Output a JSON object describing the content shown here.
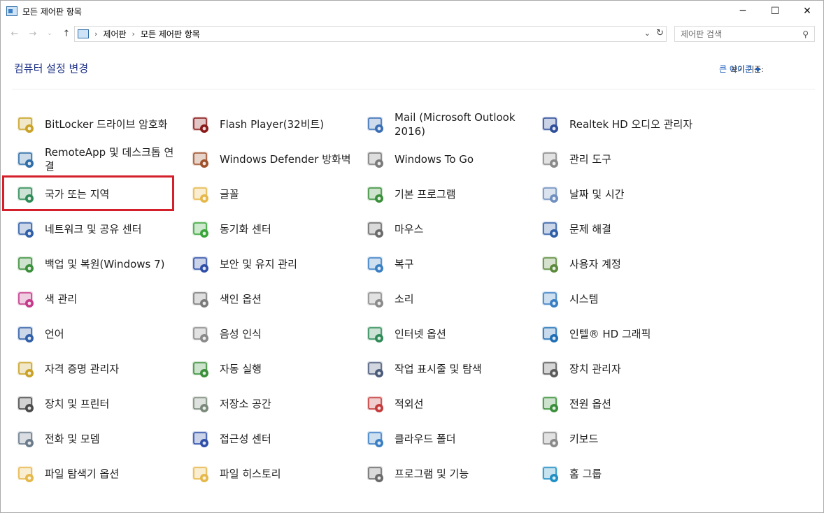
{
  "window": {
    "title": "모든 제어판 항목",
    "controls": [
      "─",
      "☐",
      "✕"
    ]
  },
  "address": {
    "crumbs": [
      "제어판",
      "모든 제어판 항목"
    ],
    "search_placeholder": "제어판 검색"
  },
  "header": {
    "title": "컴퓨터 설정 변경",
    "view_by_label": "보기 기준:",
    "view_by_value": "큰 아이콘"
  },
  "items": [
    {
      "label": "BitLocker 드라이브 암호화",
      "icon": "bitlocker-icon",
      "color": "#c9a227"
    },
    {
      "label": "Flash Player(32비트)",
      "icon": "flash-icon",
      "color": "#8b1a1a"
    },
    {
      "label": "Mail (Microsoft Outlook 2016)",
      "icon": "mail-icon",
      "color": "#3a6fb5"
    },
    {
      "label": "Realtek HD 오디오 관리자",
      "icon": "realtek-icon",
      "color": "#2f4f9a"
    },
    {
      "label": "RemoteApp 및 데스크톱 연결",
      "icon": "remoteapp-icon",
      "color": "#2f6ea8"
    },
    {
      "label": "Windows Defender 방화벽",
      "icon": "firewall-icon",
      "color": "#a0522d"
    },
    {
      "label": "Windows To Go",
      "icon": "windows-to-go-icon",
      "color": "#7a7a7a"
    },
    {
      "label": "관리 도구",
      "icon": "admin-tools-icon",
      "color": "#8a8a8a"
    },
    {
      "label": "국가 또는 지역",
      "icon": "region-icon",
      "color": "#2e8b57"
    },
    {
      "label": "글꼴",
      "icon": "fonts-icon",
      "color": "#e6b84a"
    },
    {
      "label": "기본 프로그램",
      "icon": "default-programs-icon",
      "color": "#3a8f3a"
    },
    {
      "label": "날짜 및 시간",
      "icon": "datetime-icon",
      "color": "#6f8fbf"
    },
    {
      "label": "네트워크 및 공유 센터",
      "icon": "network-icon",
      "color": "#2f5fa8"
    },
    {
      "label": "동기화 센터",
      "icon": "sync-icon",
      "color": "#3aa63a"
    },
    {
      "label": "마우스",
      "icon": "mouse-icon",
      "color": "#6a6a6a"
    },
    {
      "label": "문제 해결",
      "icon": "troubleshoot-icon",
      "color": "#2f5fa8"
    },
    {
      "label": "백업 및 복원(Windows 7)",
      "icon": "backup-icon",
      "color": "#3a8f3a"
    },
    {
      "label": "보안 및 유지 관리",
      "icon": "security-flag-icon",
      "color": "#2f4fa8"
    },
    {
      "label": "복구",
      "icon": "recovery-icon",
      "color": "#3a7fc4"
    },
    {
      "label": "사용자 계정",
      "icon": "user-accounts-icon",
      "color": "#5a8a3a"
    },
    {
      "label": "색 관리",
      "icon": "color-management-icon",
      "color": "#c43a8a"
    },
    {
      "label": "색인 옵션",
      "icon": "indexing-icon",
      "color": "#7a7a7a"
    },
    {
      "label": "소리",
      "icon": "sound-icon",
      "color": "#8a8a8a"
    },
    {
      "label": "시스템",
      "icon": "system-icon",
      "color": "#3a7fc4"
    },
    {
      "label": "언어",
      "icon": "language-icon",
      "color": "#2f5fa8"
    },
    {
      "label": "음성 인식",
      "icon": "microphone-icon",
      "color": "#8a8a8a"
    },
    {
      "label": "인터넷 옵션",
      "icon": "internet-options-icon",
      "color": "#2e8b57"
    },
    {
      "label": "인텔® HD 그래픽",
      "icon": "intel-graphics-icon",
      "color": "#1f6fb5"
    },
    {
      "label": "자격 증명 관리자",
      "icon": "credential-icon",
      "color": "#c9a227"
    },
    {
      "label": "자동 실행",
      "icon": "autoplay-icon",
      "color": "#3a8f3a"
    },
    {
      "label": "작업 표시줄 및 탐색",
      "icon": "taskbar-icon",
      "color": "#4a5a7a"
    },
    {
      "label": "장치 관리자",
      "icon": "device-manager-icon",
      "color": "#5a5a5a"
    },
    {
      "label": "장치 및 프린터",
      "icon": "printer-icon",
      "color": "#4a4a4a"
    },
    {
      "label": "저장소 공간",
      "icon": "storage-icon",
      "color": "#7a8a7a"
    },
    {
      "label": "적외선",
      "icon": "infrared-icon",
      "color": "#c43a3a"
    },
    {
      "label": "전원 옵션",
      "icon": "power-icon",
      "color": "#3a8f3a"
    },
    {
      "label": "전화 및 모뎀",
      "icon": "phone-icon",
      "color": "#6a7a8a"
    },
    {
      "label": "접근성 센터",
      "icon": "ease-of-access-icon",
      "color": "#2f4fa8"
    },
    {
      "label": "클라우드 폴더",
      "icon": "work-folders-icon",
      "color": "#3a7fc4"
    },
    {
      "label": "키보드",
      "icon": "keyboard-icon",
      "color": "#8a8a8a"
    },
    {
      "label": "파일 탐색기 옵션",
      "icon": "explorer-options-icon",
      "color": "#e6b84a"
    },
    {
      "label": "파일 히스토리",
      "icon": "file-history-icon",
      "color": "#e6b84a"
    },
    {
      "label": "프로그램 및 기능",
      "icon": "programs-features-icon",
      "color": "#6a6a6a"
    },
    {
      "label": "홈 그룹",
      "icon": "homegroup-icon",
      "color": "#1f8fc4"
    }
  ]
}
